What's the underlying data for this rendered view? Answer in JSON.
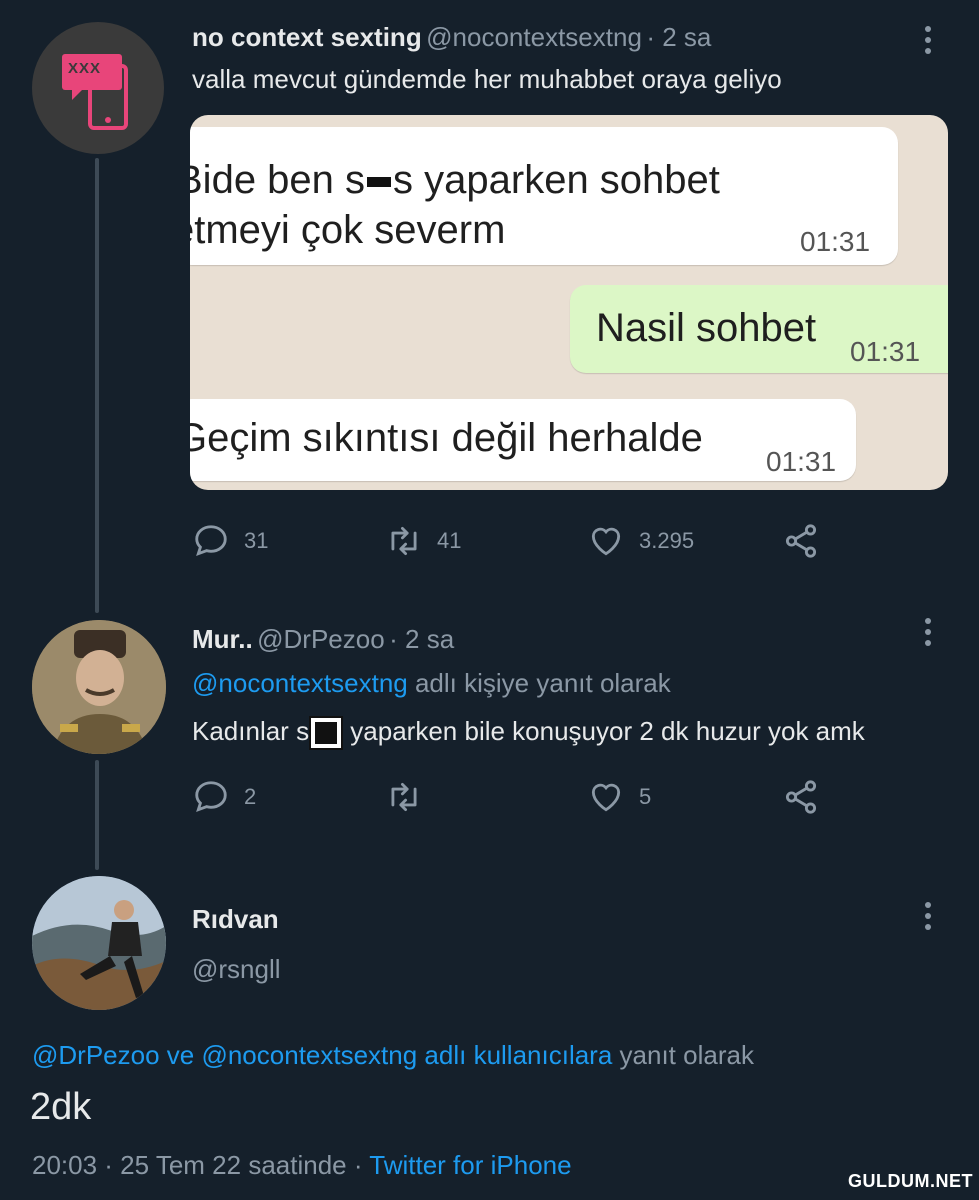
{
  "tweet1": {
    "name": "no context sexting",
    "handle": "@nocontextsextng",
    "time": "· 2 sa",
    "text": "valla mevcut gündemde her muhabbet oraya geliyo",
    "avatar_label": "XXX",
    "chat": {
      "msg1_a": "Bide ben s",
      "msg1_b": "s yaparken sohbet",
      "msg1_line2": "etmeyi çok severm",
      "msg1_time": "01:31",
      "msg2": "Nasil sohbet",
      "msg2_time": "01:31",
      "msg3": "Geçim sıkıntısı değil herhalde",
      "msg3_time": "01:31"
    },
    "replies": "31",
    "retweets": "41",
    "likes": "3.295"
  },
  "tweet2": {
    "name": "Mur..",
    "handle": "@DrPezoo",
    "time": "· 2 sa",
    "reply_to_handle": "@nocontextsextng",
    "reply_to_suffix": " adlı kişiye yanıt olarak",
    "text_a": "Kadınlar s",
    "text_b": " yaparken bile konuşuyor 2 dk huzur yok amk",
    "replies": "2",
    "retweets": "",
    "likes": "5"
  },
  "tweet3": {
    "name": "Rıdvan",
    "handle": "@rsngll",
    "reply_to_links": "@DrPezoo ve @nocontextsextng adlı kullanıcılara",
    "reply_to_suffix": " yanıt olarak",
    "text": "2dk",
    "timestamp": "20:03 · 25 Tem 22 saatinde · ",
    "source": "Twitter for iPhone"
  },
  "watermark": "GULDUM.NET",
  "colors": {
    "background": "#15202b",
    "link": "#1d9bf0",
    "muted": "#8b98a5"
  }
}
